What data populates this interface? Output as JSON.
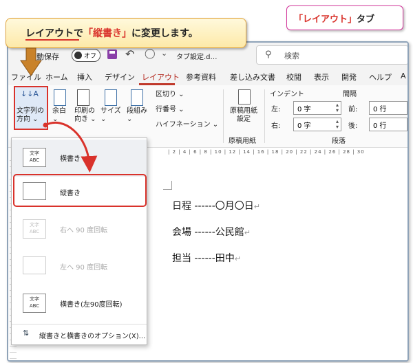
{
  "callouts": {
    "main_prefix": "レイアウトで",
    "main_highlight": "「縦書き」",
    "main_suffix": "に変更します。",
    "tab_highlight": "「レイアウト」",
    "tab_suffix": "タブ"
  },
  "titlebar": {
    "autosave_label": "自動保存",
    "autosave_state": "オフ",
    "doc_title": "タブ設定.d…",
    "search_placeholder": "検索",
    "undo_icon": "↶",
    "redo_icon": "◯",
    "more_icon": "⌄",
    "search_icon": "⚲"
  },
  "tabs": [
    "ファイル",
    "ホーム",
    "挿入",
    "デザイン",
    "レイアウト",
    "参考資料",
    "差し込み文書",
    "校閲",
    "表示",
    "開発",
    "ヘルプ",
    "A"
  ],
  "ribbon": {
    "text_direction": "文字列の\n方向 ⌄",
    "margins": "余白\n⌄",
    "orientation": "印刷の\n向き ⌄",
    "size": "サイズ\n⌄",
    "columns": "段組み\n⌄",
    "breaks": "区切り ⌄",
    "line_numbers": "行番号 ⌄",
    "hyphenation": "ハイフネーション ⌄",
    "manuscript": "原稿用紙\n設定",
    "manuscript_group": "原稿用紙",
    "indent_header": "インデント",
    "spacing_header": "間隔",
    "indent_left_label": "左:",
    "indent_left_value": "0 字",
    "indent_right_label": "右:",
    "indent_right_value": "0 字",
    "spacing_before_label": "前:",
    "spacing_before_value": "0 行",
    "spacing_after_label": "後:",
    "spacing_after_value": "0 行",
    "paragraph_group": "段落"
  },
  "ruler": "| 2 | 4 | 6 | 8 | 10 | 12 | 14 | 16 | 18 | 20 | 22 | 24 | 26 | 28 | 30",
  "document": {
    "line1": "日程 ------〇月〇日",
    "line2": "会場 ------公民館",
    "line3": "担当 ------田中",
    "para_mark": "↵"
  },
  "dropdown": {
    "items": [
      {
        "label": "横書き",
        "icon_text": "文字\nABC",
        "enabled": true
      },
      {
        "label": "縦書き",
        "icon_text": "",
        "enabled": true
      },
      {
        "label": "右へ 90 度回転",
        "icon_text": "文字\nABC",
        "enabled": false
      },
      {
        "label": "左へ 90 度回転",
        "icon_text": "",
        "enabled": false
      },
      {
        "label": "横書き(左90度回転)",
        "icon_text": "文字\nABC",
        "enabled": true
      }
    ],
    "options_label": "縦書きと横書きのオプション(X)...",
    "options_icon": "⇅"
  },
  "colors": {
    "accent_red": "#d9322b",
    "callout_border": "#e0a33a",
    "tab_callout_border": "#d2339a"
  }
}
